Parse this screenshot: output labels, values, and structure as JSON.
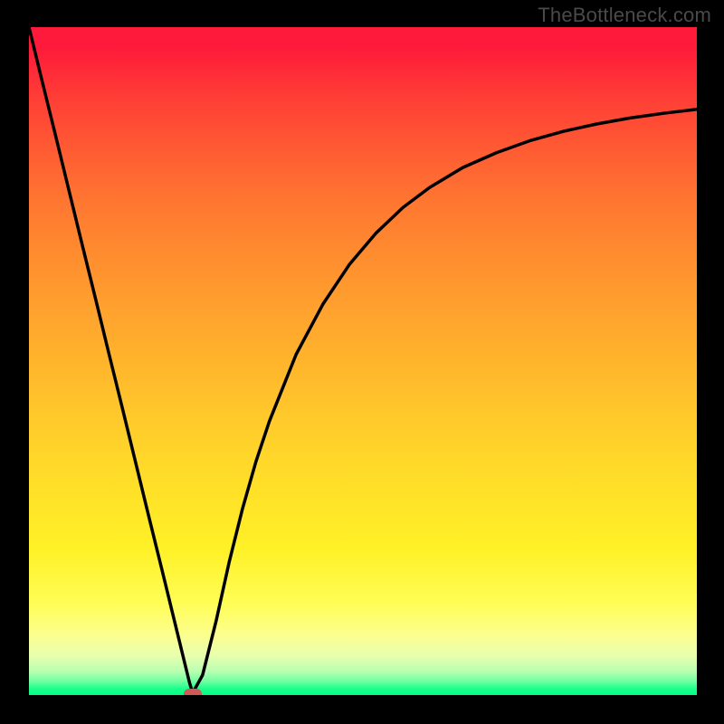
{
  "watermark": "TheBottleneck.com",
  "colors": {
    "frame": "#000000",
    "curve": "#000000",
    "marker": "#cd5a54",
    "watermark": "#4a4a4a"
  },
  "chart_data": {
    "type": "line",
    "title": "",
    "xlabel": "",
    "ylabel": "",
    "xlim": [
      0,
      100
    ],
    "ylim": [
      0,
      100
    ],
    "grid": false,
    "legend": "none",
    "annotations": [
      "TheBottleneck.com"
    ],
    "marker": {
      "x": 24.5,
      "y": 0
    },
    "series": [
      {
        "name": "curve",
        "x": [
          0,
          2,
          4,
          6,
          8,
          10,
          12,
          14,
          16,
          18,
          20,
          22,
          24,
          24.5,
          26,
          28,
          30,
          32,
          34,
          36,
          40,
          44,
          48,
          52,
          56,
          60,
          65,
          70,
          75,
          80,
          85,
          90,
          95,
          100
        ],
        "y": [
          100,
          91.8,
          83.7,
          75.5,
          67.3,
          59.2,
          51.0,
          42.9,
          34.7,
          26.5,
          18.4,
          10.2,
          2.0,
          0.3,
          3.0,
          11.0,
          20.0,
          28.0,
          35.0,
          41.0,
          51.0,
          58.5,
          64.5,
          69.2,
          73.0,
          76.0,
          79.0,
          81.2,
          83.0,
          84.4,
          85.5,
          86.4,
          87.1,
          87.7
        ]
      }
    ]
  }
}
